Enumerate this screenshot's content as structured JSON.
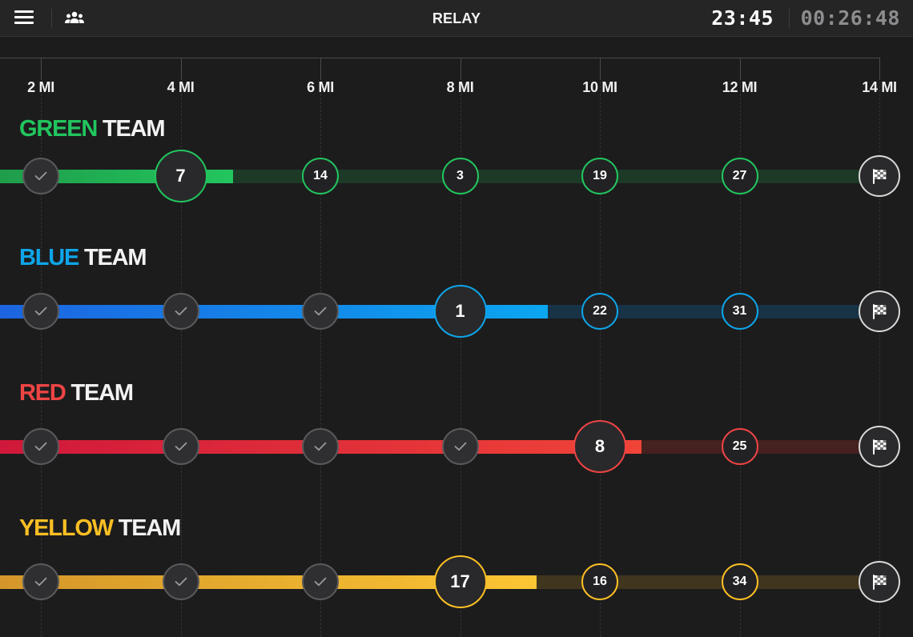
{
  "header": {
    "title": "RELAY",
    "clock": "23:45",
    "elapsed": "00:26:48",
    "menu_icon": "hamburger-menu-icon",
    "team_icon": "team-people-icon"
  },
  "ruler": {
    "ticks": [
      "2 MI",
      "4 MI",
      "6 MI",
      "8 MI",
      "10 MI",
      "12 MI",
      "14 MI"
    ]
  },
  "teams": [
    {
      "id": "green",
      "name_color_word": "GREEN",
      "name_suffix": "TEAM",
      "color": "#22c55e",
      "track_dim": "#1d3a27",
      "fill_start": "#1f9d4a",
      "fill_end": "#22c55e",
      "progress_mi": 4.75,
      "completed_count": 1,
      "current_runner": "7",
      "upcoming_runners": [
        "14",
        "3",
        "19",
        "27"
      ]
    },
    {
      "id": "blue",
      "name_color_word": "BLUE",
      "name_suffix": "TEAM",
      "color": "#0ea5e9",
      "track_dim": "#183246",
      "fill_start": "#1d64e0",
      "fill_end": "#0ba6f0",
      "progress_mi": 9.25,
      "completed_count": 3,
      "current_runner": "1",
      "upcoming_runners": [
        "22",
        "31"
      ]
    },
    {
      "id": "red",
      "name_color_word": "RED",
      "name_suffix": "TEAM",
      "color": "#ef4444",
      "track_dim": "#45211f",
      "fill_start": "#d0183a",
      "fill_end": "#f04438",
      "progress_mi": 10.6,
      "completed_count": 4,
      "current_runner": "8",
      "upcoming_runners": [
        "25"
      ]
    },
    {
      "id": "yellow",
      "name_color_word": "YELLOW",
      "name_suffix": "TEAM",
      "color": "#fbbf24",
      "track_dim": "#40361e",
      "fill_start": "#d4962a",
      "fill_end": "#fbc534",
      "progress_mi": 9.1,
      "completed_count": 3,
      "current_runner": "17",
      "upcoming_runners": [
        "16",
        "34"
      ]
    }
  ]
}
